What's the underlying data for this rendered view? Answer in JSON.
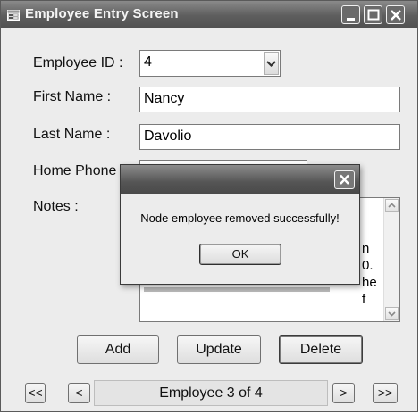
{
  "window": {
    "title": "Employee Entry Screen",
    "icon": "form-icon",
    "controls": [
      "minimize-icon",
      "maximize-icon",
      "close-icon"
    ]
  },
  "form": {
    "employee_id": {
      "label": "Employee ID :",
      "value": "4"
    },
    "first_name": {
      "label": "First Name :",
      "value": "Nancy"
    },
    "last_name": {
      "label": "Last Name :",
      "value": "Davolio"
    },
    "home_phone": {
      "label": "Home Phone",
      "value": ""
    },
    "notes": {
      "label": "Notes :",
      "visible_fragments": [
        "n",
        "0.",
        "he",
        "f"
      ]
    }
  },
  "actions": {
    "add": "Add",
    "update": "Update",
    "delete": "Delete"
  },
  "navigator": {
    "first": "<<",
    "prev": "<",
    "status": "Employee 3 of 4",
    "next": ">",
    "last": ">>"
  },
  "dialog": {
    "message": "Node employee removed successfully!",
    "ok_label": "OK",
    "close_icon": "close-icon"
  },
  "colors": {
    "titlebar": "#5e5e5e",
    "window_bg": "#ececec"
  }
}
